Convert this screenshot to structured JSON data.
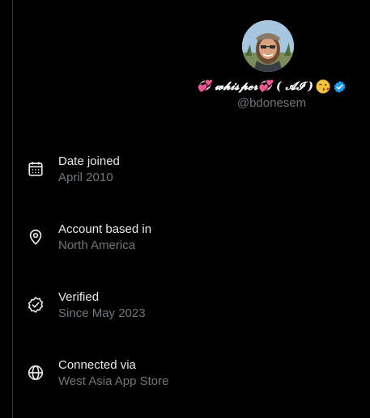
{
  "profile": {
    "display_name_left": "💞 𝔀𝓱𝓲𝓼𝓹𝓮𝓻💞 ( 𝓐𝓘 )",
    "display_name_emoji": "kissing-wink-face",
    "verified_badge": "blue-check",
    "handle": "@bdonesem",
    "avatar": "profile-photo"
  },
  "about": {
    "items": [
      {
        "icon": "calendar-icon",
        "title": "Date joined",
        "value": "April 2010"
      },
      {
        "icon": "location-pin-icon",
        "title": "Account based in",
        "value": "North America"
      },
      {
        "icon": "verified-badge-icon",
        "title": "Verified",
        "value": "Since May 2023"
      },
      {
        "icon": "globe-icon",
        "title": "Connected via",
        "value": "West Asia App Store"
      }
    ]
  },
  "colors": {
    "background": "#000000",
    "primary_text": "#e7e9ea",
    "secondary_text": "#71767b",
    "border": "#2f3336",
    "verified_blue": "#1d9bf0"
  }
}
